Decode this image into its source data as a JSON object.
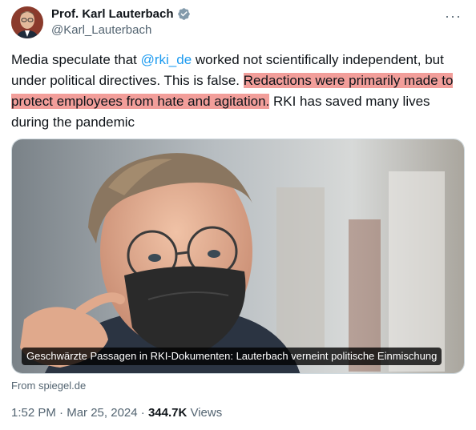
{
  "author": {
    "display_name": "Prof. Karl Lauterbach",
    "handle": "@Karl_Lauterbach"
  },
  "tweet": {
    "text_part1": "Media speculate that ",
    "mention": "@rki_de",
    "text_part2": " worked not scientifically independent, but under political directives. This is false. ",
    "highlighted": "Redactions were primarily made to protect employees from hate and agitation.",
    "text_part3": " RKI has saved many lives during the pandemic"
  },
  "card": {
    "caption": "Geschwärzte Passagen in RKI-Dokumenten: Lauterbach verneint politische Einmischung",
    "source": "From spiegel.de"
  },
  "meta": {
    "time": "1:52 PM",
    "sep1": " · ",
    "date": "Mar 25, 2024",
    "sep2": " · ",
    "views_count": "344.7K",
    "views_label": " Views"
  },
  "colors": {
    "link": "#1d9bf0",
    "highlight": "#f29e9a",
    "secondary_text": "#536471",
    "verified": "#829aab"
  },
  "icons": {
    "verified": "verified-badge-icon",
    "more": "more-options-icon"
  }
}
